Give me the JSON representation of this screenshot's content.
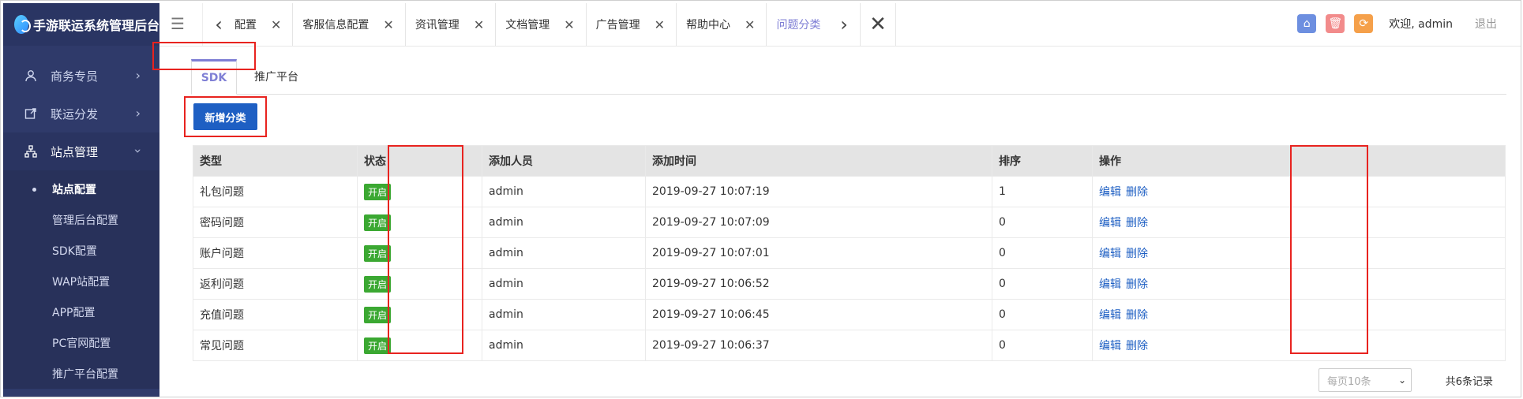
{
  "app": {
    "title": "手游联运系统管理后台"
  },
  "sidebar": {
    "items": [
      {
        "label": "商务专员",
        "icon": "user-icon"
      },
      {
        "label": "联运分发",
        "icon": "share-icon"
      },
      {
        "label": "站点管理",
        "icon": "sitemap-icon"
      }
    ],
    "sub_items": [
      "站点配置",
      "管理后台配置",
      "SDK配置",
      "WAP站配置",
      "APP配置",
      "PC官网配置",
      "推广平台配置"
    ]
  },
  "topbar": {
    "page_tabs": [
      "台配置",
      "客服信息配置",
      "资讯管理",
      "文档管理",
      "广告管理",
      "帮助中心",
      "问题分类"
    ],
    "welcome": "欢迎, admin",
    "logout": "退出"
  },
  "content": {
    "tabs": [
      "SDK",
      "推广平台"
    ],
    "add_button": "新增分类",
    "table": {
      "headers": [
        "类型",
        "状态",
        "添加人员",
        "添加时间",
        "排序",
        "操作"
      ],
      "rows": [
        {
          "type": "礼包问题",
          "status": "开启",
          "user": "admin",
          "time": "2019-09-27 10:07:19",
          "sort": "1"
        },
        {
          "type": "密码问题",
          "status": "开启",
          "user": "admin",
          "time": "2019-09-27 10:07:09",
          "sort": "0"
        },
        {
          "type": "账户问题",
          "status": "开启",
          "user": "admin",
          "time": "2019-09-27 10:07:01",
          "sort": "0"
        },
        {
          "type": "返利问题",
          "status": "开启",
          "user": "admin",
          "time": "2019-09-27 10:06:52",
          "sort": "0"
        },
        {
          "type": "充值问题",
          "status": "开启",
          "user": "admin",
          "time": "2019-09-27 10:06:45",
          "sort": "0"
        },
        {
          "type": "常见问题",
          "status": "开启",
          "user": "admin",
          "time": "2019-09-27 10:06:37",
          "sort": "0"
        }
      ],
      "action_edit": "编辑",
      "action_delete": "删除"
    },
    "pagination": {
      "per_page": "每页10条",
      "total": "共6条记录"
    }
  },
  "colors": {
    "sidebar": "#2f3a6a",
    "accent": "#7f7fd5",
    "primary_button": "#1e5fc3",
    "status_green": "#3ba832",
    "annotation_red": "#e8231f"
  }
}
